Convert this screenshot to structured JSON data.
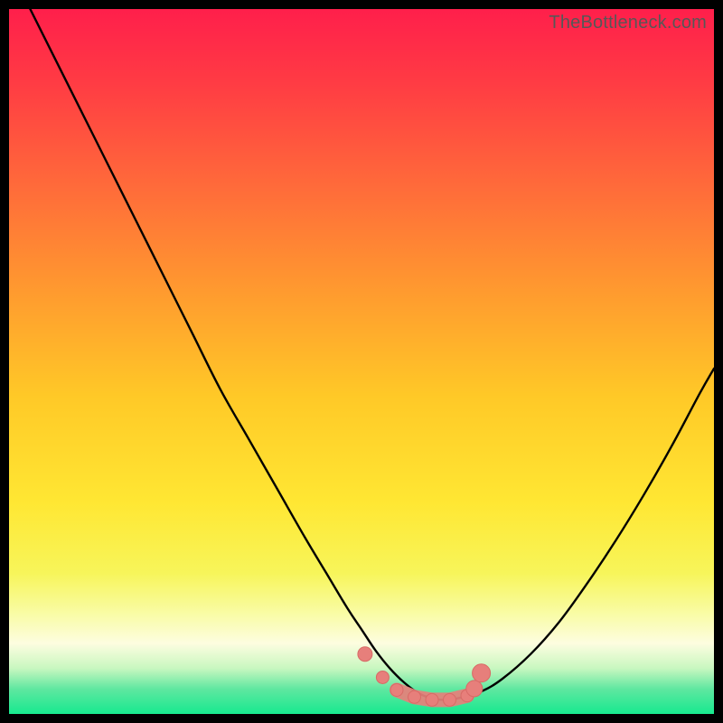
{
  "watermark": {
    "text": "TheBottleneck.com"
  },
  "colors": {
    "frame": "#000000",
    "gradient_stops": [
      {
        "offset": 0.0,
        "color": "#ff1f4b"
      },
      {
        "offset": 0.1,
        "color": "#ff3a44"
      },
      {
        "offset": 0.25,
        "color": "#ff6a3a"
      },
      {
        "offset": 0.4,
        "color": "#ff9a2f"
      },
      {
        "offset": 0.55,
        "color": "#ffc927"
      },
      {
        "offset": 0.7,
        "color": "#ffe733"
      },
      {
        "offset": 0.8,
        "color": "#f7f55a"
      },
      {
        "offset": 0.86,
        "color": "#f9fca8"
      },
      {
        "offset": 0.9,
        "color": "#fdfde0"
      },
      {
        "offset": 0.935,
        "color": "#c9f7c0"
      },
      {
        "offset": 0.965,
        "color": "#5ee7a0"
      },
      {
        "offset": 1.0,
        "color": "#17e98f"
      }
    ],
    "curve": "#000000",
    "marker_fill": "#e77f7b",
    "marker_stroke": "#d86a66"
  },
  "chart_data": {
    "type": "line",
    "title": "",
    "xlabel": "",
    "ylabel": "",
    "xlim": [
      0,
      100
    ],
    "ylim": [
      0,
      100
    ],
    "grid": false,
    "legend": false,
    "series": [
      {
        "name": "bottleneck-curve",
        "x": [
          3,
          6,
          10,
          14,
          18,
          22,
          26,
          30,
          34,
          38,
          42,
          45,
          48,
          50,
          52,
          54,
          56,
          58,
          60,
          62,
          64,
          67,
          70,
          74,
          78,
          82,
          86,
          90,
          94,
          98,
          100
        ],
        "y": [
          100,
          94,
          86,
          78,
          70,
          62,
          54,
          46,
          39,
          32,
          25,
          20,
          15,
          12,
          9,
          6.5,
          4.5,
          3,
          2.2,
          2,
          2.3,
          3.2,
          5,
          8.5,
          13,
          18.5,
          24.5,
          31,
          38,
          45.5,
          49
        ]
      }
    ],
    "markers": {
      "name": "highlight-points",
      "x": [
        50.5,
        53,
        55,
        57.5,
        60,
        62.5,
        65,
        66,
        67
      ],
      "y": [
        8.5,
        5.2,
        3.4,
        2.4,
        2.0,
        2.0,
        2.6,
        3.6,
        5.8
      ]
    }
  }
}
